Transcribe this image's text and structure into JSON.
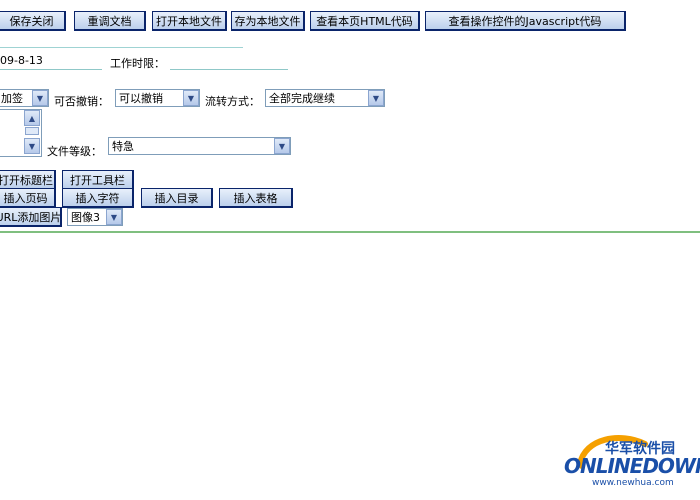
{
  "toolbar": {
    "save_close": "保存关闭",
    "redo_doc": "重调文档",
    "open_local": "打开本地文件",
    "save_local": "存为本地文件",
    "view_html": "查看本页HTML代码",
    "view_js": "查看操作控件的Javascript代码"
  },
  "form": {
    "date_value": "09-8-13",
    "work_limit_label": "工作时限：",
    "work_limit_value": "",
    "sign_select": "加签",
    "undo_label": "可否撤销：",
    "undo_select": "可以撤销",
    "flow_label": "流转方式：",
    "flow_select": "全部完成继续",
    "level_label": "文件等级：",
    "level_select": "特急"
  },
  "actions": {
    "open_title_bar": "打开标题栏",
    "open_toolbar": "打开工具栏",
    "insert_page_no": "插入页码",
    "insert_char": "插入字符",
    "insert_toc": "插入目录",
    "insert_table": "插入表格",
    "add_image_url": "URL添加图片",
    "image_select": "图像3"
  },
  "watermark": {
    "cn": "华军软件园",
    "en": "ONLINEDOWN",
    "url": "www.newhua.com"
  },
  "colors": {
    "button_border": "#0a246a",
    "divider": "#7fbf7f",
    "logo_orange": "#f5a000",
    "logo_blue": "#1a4fa8"
  }
}
